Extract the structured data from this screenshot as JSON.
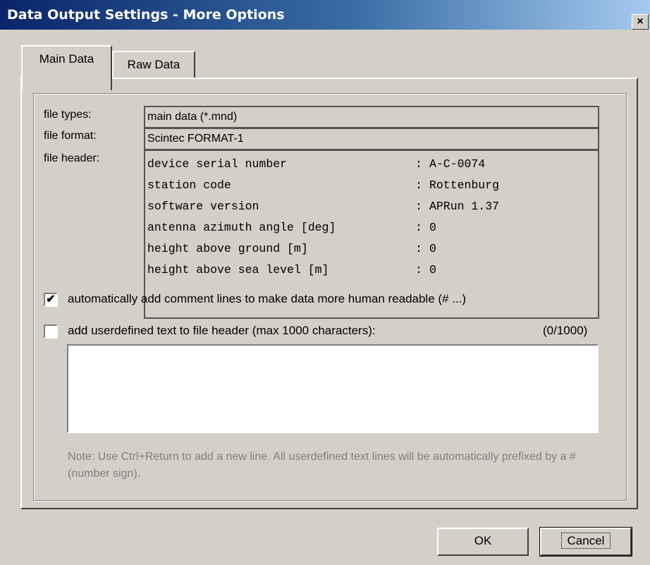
{
  "window": {
    "title": "Data Output Settings - More Options",
    "close_label": "×"
  },
  "tabs": [
    {
      "label": "Main Data"
    },
    {
      "label": "Raw Data"
    }
  ],
  "file_types": {
    "label": "file types:",
    "value": "main data (*.mnd)"
  },
  "file_format": {
    "label": "file format:",
    "value": "Scintec FORMAT-1"
  },
  "file_header": {
    "label": "file header:",
    "rows": [
      {
        "key": "device serial number",
        "sep": ":",
        "value": "A-C-0074"
      },
      {
        "key": "station code",
        "sep": ":",
        "value": "Rottenburg"
      },
      {
        "key": "software version",
        "sep": ":",
        "value": "APRun 1.37"
      },
      {
        "key": "antenna azimuth angle [deg]",
        "sep": ":",
        "value": "0"
      },
      {
        "key": "height above ground [m]",
        "sep": ":",
        "value": "0"
      },
      {
        "key": "height above sea level [m]",
        "sep": ":",
        "value": "0"
      }
    ]
  },
  "auto_comment": {
    "label": "automatically add comment lines to make data more human readable (# ...)",
    "checked": true,
    "mark": "✔"
  },
  "user_text": {
    "label": "add userdefined text to file header (max 1000 characters):",
    "counter": "(0/1000)",
    "checked": false,
    "value": ""
  },
  "note": "Note: Use Ctrl+Return to add a new line. All userdefined text lines will be automatically prefixed by a # (number sign).",
  "buttons": {
    "ok": "OK",
    "cancel": "Cancel"
  }
}
